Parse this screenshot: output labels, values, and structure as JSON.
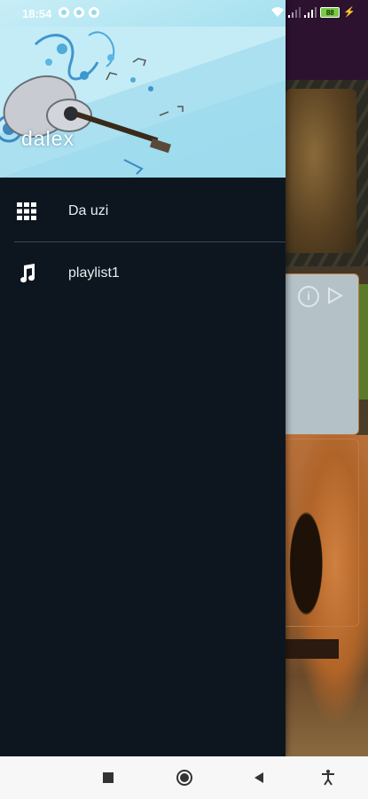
{
  "status_bar": {
    "time": "18:54",
    "battery": "88",
    "icons": [
      "settings-icon",
      "circle-app-icon",
      "facebook-icon",
      "wifi-icon",
      "signal-icon",
      "signal-icon",
      "battery-icon",
      "charging-icon"
    ]
  },
  "drawer": {
    "header_name": "dalex",
    "items": [
      {
        "label": "Da uzi",
        "icon": "grid-icon"
      },
      {
        "label": "playlist1",
        "icon": "music-note-icon"
      }
    ]
  },
  "nav_bar": {
    "buttons": [
      "recents-square-icon",
      "home-circle-icon",
      "back-triangle-icon",
      "accessibility-icon"
    ]
  },
  "colors": {
    "drawer_bg": "#0d161f",
    "header_bg": "#a9e2f0",
    "text": "#e6ecef",
    "navbar_bg": "#f7f7f7"
  }
}
